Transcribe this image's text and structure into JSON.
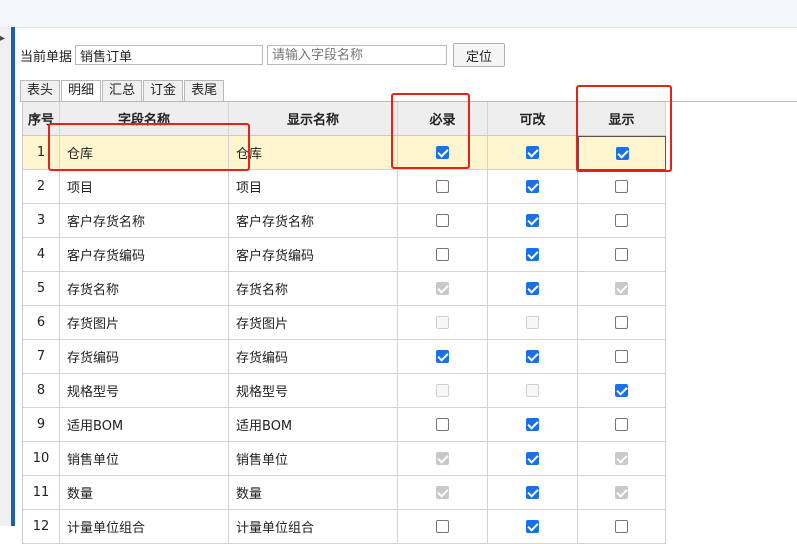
{
  "toolbar": {
    "doc_label": "当前单据",
    "doc_value": "销售订单",
    "search_placeholder": "请输入字段名称",
    "locate_button": "定位"
  },
  "tabs": [
    {
      "label": "表头",
      "active": false
    },
    {
      "label": "明细",
      "active": true
    },
    {
      "label": "汇总",
      "active": false
    },
    {
      "label": "订金",
      "active": false
    },
    {
      "label": "表尾",
      "active": false
    }
  ],
  "columns": {
    "seq": "序号",
    "field": "字段名称",
    "display": "显示名称",
    "required": "必录",
    "editable": "可改",
    "visible": "显示"
  },
  "rows": [
    {
      "seq": "1",
      "field": "仓库",
      "display": "仓库",
      "required": {
        "checked": true,
        "disabled": false
      },
      "editable": {
        "checked": true,
        "disabled": false
      },
      "visible": {
        "checked": true,
        "disabled": false
      }
    },
    {
      "seq": "2",
      "field": "项目",
      "display": "项目",
      "required": {
        "checked": false,
        "disabled": false
      },
      "editable": {
        "checked": true,
        "disabled": false
      },
      "visible": {
        "checked": false,
        "disabled": false
      }
    },
    {
      "seq": "3",
      "field": "客户存货名称",
      "display": "客户存货名称",
      "required": {
        "checked": false,
        "disabled": false
      },
      "editable": {
        "checked": true,
        "disabled": false
      },
      "visible": {
        "checked": false,
        "disabled": false
      }
    },
    {
      "seq": "4",
      "field": "客户存货编码",
      "display": "客户存货编码",
      "required": {
        "checked": false,
        "disabled": false
      },
      "editable": {
        "checked": true,
        "disabled": false
      },
      "visible": {
        "checked": false,
        "disabled": false
      }
    },
    {
      "seq": "5",
      "field": "存货名称",
      "display": "存货名称",
      "required": {
        "checked": true,
        "disabled": true
      },
      "editable": {
        "checked": true,
        "disabled": false
      },
      "visible": {
        "checked": true,
        "disabled": true
      }
    },
    {
      "seq": "6",
      "field": "存货图片",
      "display": "存货图片",
      "required": {
        "checked": false,
        "disabled": true
      },
      "editable": {
        "checked": false,
        "disabled": true
      },
      "visible": {
        "checked": false,
        "disabled": false
      }
    },
    {
      "seq": "7",
      "field": "存货编码",
      "display": "存货编码",
      "required": {
        "checked": true,
        "disabled": false
      },
      "editable": {
        "checked": true,
        "disabled": false
      },
      "visible": {
        "checked": false,
        "disabled": false
      }
    },
    {
      "seq": "8",
      "field": "规格型号",
      "display": "规格型号",
      "required": {
        "checked": false,
        "disabled": true
      },
      "editable": {
        "checked": false,
        "disabled": true
      },
      "visible": {
        "checked": true,
        "disabled": false
      }
    },
    {
      "seq": "9",
      "field": "适用BOM",
      "display": "适用BOM",
      "required": {
        "checked": false,
        "disabled": false
      },
      "editable": {
        "checked": true,
        "disabled": false
      },
      "visible": {
        "checked": false,
        "disabled": false
      }
    },
    {
      "seq": "10",
      "field": "销售单位",
      "display": "销售单位",
      "required": {
        "checked": true,
        "disabled": true
      },
      "editable": {
        "checked": true,
        "disabled": false
      },
      "visible": {
        "checked": true,
        "disabled": true
      }
    },
    {
      "seq": "11",
      "field": "数量",
      "display": "数量",
      "required": {
        "checked": true,
        "disabled": true
      },
      "editable": {
        "checked": true,
        "disabled": false
      },
      "visible": {
        "checked": true,
        "disabled": true
      }
    },
    {
      "seq": "12",
      "field": "计量单位组合",
      "display": "计量单位组合",
      "required": {
        "checked": false,
        "disabled": false
      },
      "editable": {
        "checked": true,
        "disabled": false
      },
      "visible": {
        "checked": false,
        "disabled": false
      }
    }
  ],
  "colors": {
    "accent": "#1672e6",
    "highlight": "#e5231b",
    "selected_row": "#fff5cf"
  }
}
